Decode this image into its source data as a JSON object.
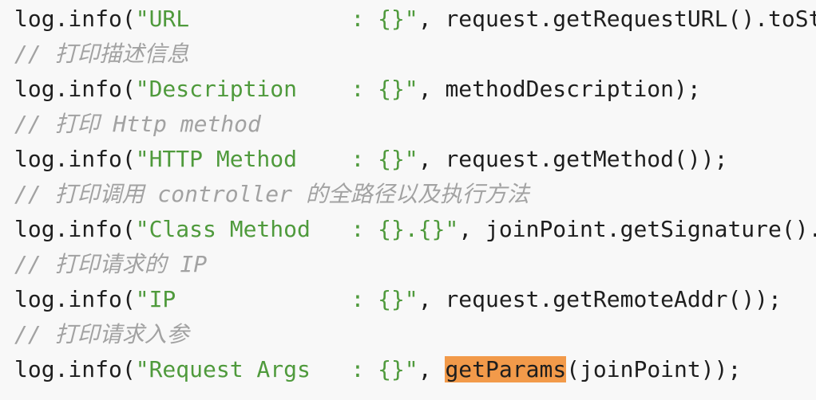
{
  "colors": {
    "background": "#f8f8f8",
    "code": "#1e1e1e",
    "string": "#4f9a3c",
    "comment": "#a2a2a2",
    "highlight": "#f29a4a"
  },
  "lines": [
    {
      "type": "code",
      "prefix": "log.info(",
      "str": "\"URL            : {}\"",
      "suffix": ", request.getRequestURL().toSt"
    },
    {
      "type": "comment",
      "text": "// 打印描述信息"
    },
    {
      "type": "code",
      "prefix": "log.info(",
      "str": "\"Description    : {}\"",
      "suffix": ", methodDescription);"
    },
    {
      "type": "comment",
      "text": "// 打印 Http method"
    },
    {
      "type": "code",
      "prefix": "log.info(",
      "str": "\"HTTP Method    : {}\"",
      "suffix": ", request.getMethod());"
    },
    {
      "type": "comment",
      "text": "// 打印调用 controller 的全路径以及执行方法"
    },
    {
      "type": "code",
      "prefix": "log.info(",
      "str": "\"Class Method   : {}.{}\"",
      "suffix": ", joinPoint.getSignature()."
    },
    {
      "type": "comment",
      "text": "// 打印请求的 IP"
    },
    {
      "type": "code",
      "prefix": "log.info(",
      "str": "\"IP             : {}\"",
      "suffix": ", request.getRemoteAddr());"
    },
    {
      "type": "comment",
      "text": "// 打印请求入参"
    },
    {
      "type": "code",
      "prefix": "log.info(",
      "str": "\"Request Args   : {}\"",
      "mid": ", ",
      "highlight": "getParams",
      "suffix": "(joinPoint));"
    }
  ]
}
